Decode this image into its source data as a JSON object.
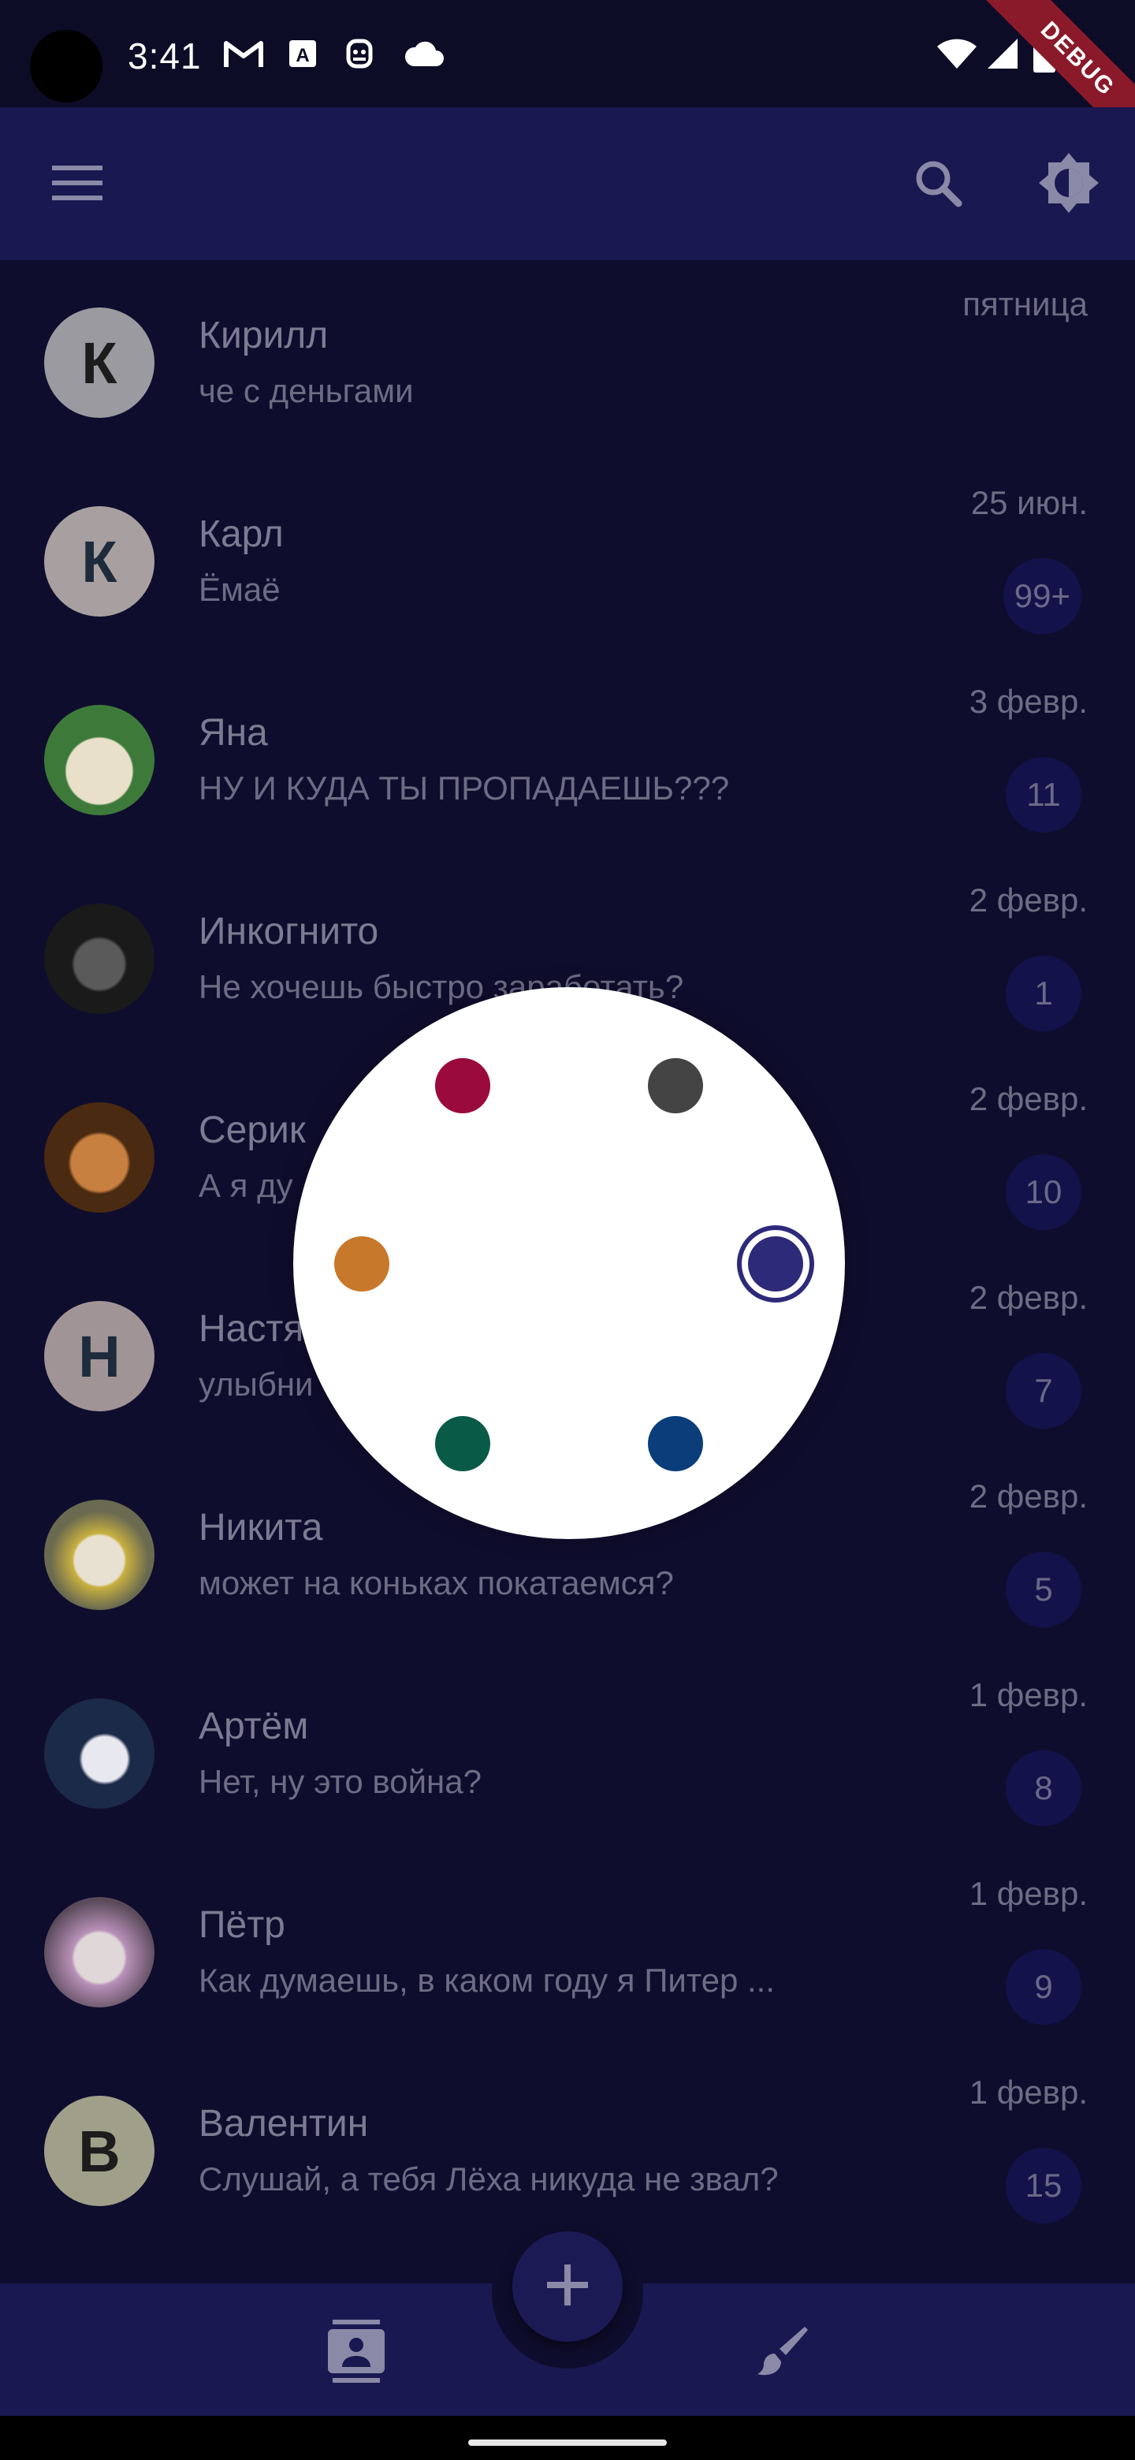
{
  "status_bar": {
    "time": "3:41",
    "debug_label": "DEBUG",
    "icons": [
      "gmail-icon",
      "a-box-icon",
      "robot-icon",
      "cloud-icon",
      "wifi-icon",
      "signal-icon",
      "battery-icon"
    ]
  },
  "app_bar": {
    "menu_icon": "menu-icon",
    "search_icon": "search-icon",
    "theme_icon": "brightness-icon"
  },
  "chats": [
    {
      "name": "Кирилл",
      "message": "че с деньгами",
      "date": "пятница",
      "badge": "",
      "avatar_letter": "К",
      "avatar_bg": "#9a9aa0",
      "avatar_fg": "#1c1c1c"
    },
    {
      "name": "Карл",
      "message": "Ёмаё",
      "date": "25 июн.",
      "badge": "99+",
      "avatar_letter": "К",
      "avatar_bg": "#a8a0a0",
      "avatar_fg": "#1d2b3c"
    },
    {
      "name": "Яна",
      "message": "НУ И КУДА ТЫ ПРОПАДАЕШЬ???",
      "date": "3 февр.",
      "badge": "11",
      "avatar_letter": "",
      "avatar_bg": "#4a7a4a",
      "avatar_fg": "#fff"
    },
    {
      "name": "Инкогнито",
      "message": "Не хочешь быстро заработать?",
      "date": "2 февр.",
      "badge": "1",
      "avatar_letter": "",
      "avatar_bg": "#2b2b2b",
      "avatar_fg": "#fff"
    },
    {
      "name": "Серик",
      "message": "А я ду",
      "date": "2 февр.",
      "badge": "10",
      "avatar_letter": "",
      "avatar_bg": "#7a4a20",
      "avatar_fg": "#fff"
    },
    {
      "name": "Настя",
      "message": "улыбни",
      "date": "2 февр.",
      "badge": "7",
      "avatar_letter": "Н",
      "avatar_bg": "#a09496",
      "avatar_fg": "#1d2b3c"
    },
    {
      "name": "Никита",
      "message": "может на коньках покатаемся?",
      "date": "2 февр.",
      "badge": "5",
      "avatar_letter": "",
      "avatar_bg": "#b8aa48",
      "avatar_fg": "#fff"
    },
    {
      "name": "Артём",
      "message": "Нет, ну это война?",
      "date": "1 февр.",
      "badge": "8",
      "avatar_letter": "",
      "avatar_bg": "#2a3a5a",
      "avatar_fg": "#fff"
    },
    {
      "name": "Пётр",
      "message": "Как думаешь, в каком году я Питер ...",
      "date": "1 февр.",
      "badge": "9",
      "avatar_letter": "",
      "avatar_bg": "#8a7a8a",
      "avatar_fg": "#fff"
    },
    {
      "name": "Валентин",
      "message": "Слушай, а тебя Лёха никуда не звал?",
      "date": "1 февр.",
      "badge": "15",
      "avatar_letter": "В",
      "avatar_bg": "#a0a08a",
      "avatar_fg": "#1c1c1c"
    }
  ],
  "color_picker": {
    "colors": [
      {
        "name": "crimson",
        "hex": "#9b0a3c",
        "selected": false
      },
      {
        "name": "gray",
        "hex": "#444444",
        "selected": false
      },
      {
        "name": "orange",
        "hex": "#c8782a",
        "selected": false
      },
      {
        "name": "indigo",
        "hex": "#2e2a7a",
        "selected": true
      },
      {
        "name": "green",
        "hex": "#0a5a48",
        "selected": false
      },
      {
        "name": "blue",
        "hex": "#0a3d7a",
        "selected": false
      }
    ]
  },
  "bottom_bar": {
    "contacts_icon": "contacts-icon",
    "add_icon": "plus-icon",
    "brush_icon": "brush-icon"
  }
}
